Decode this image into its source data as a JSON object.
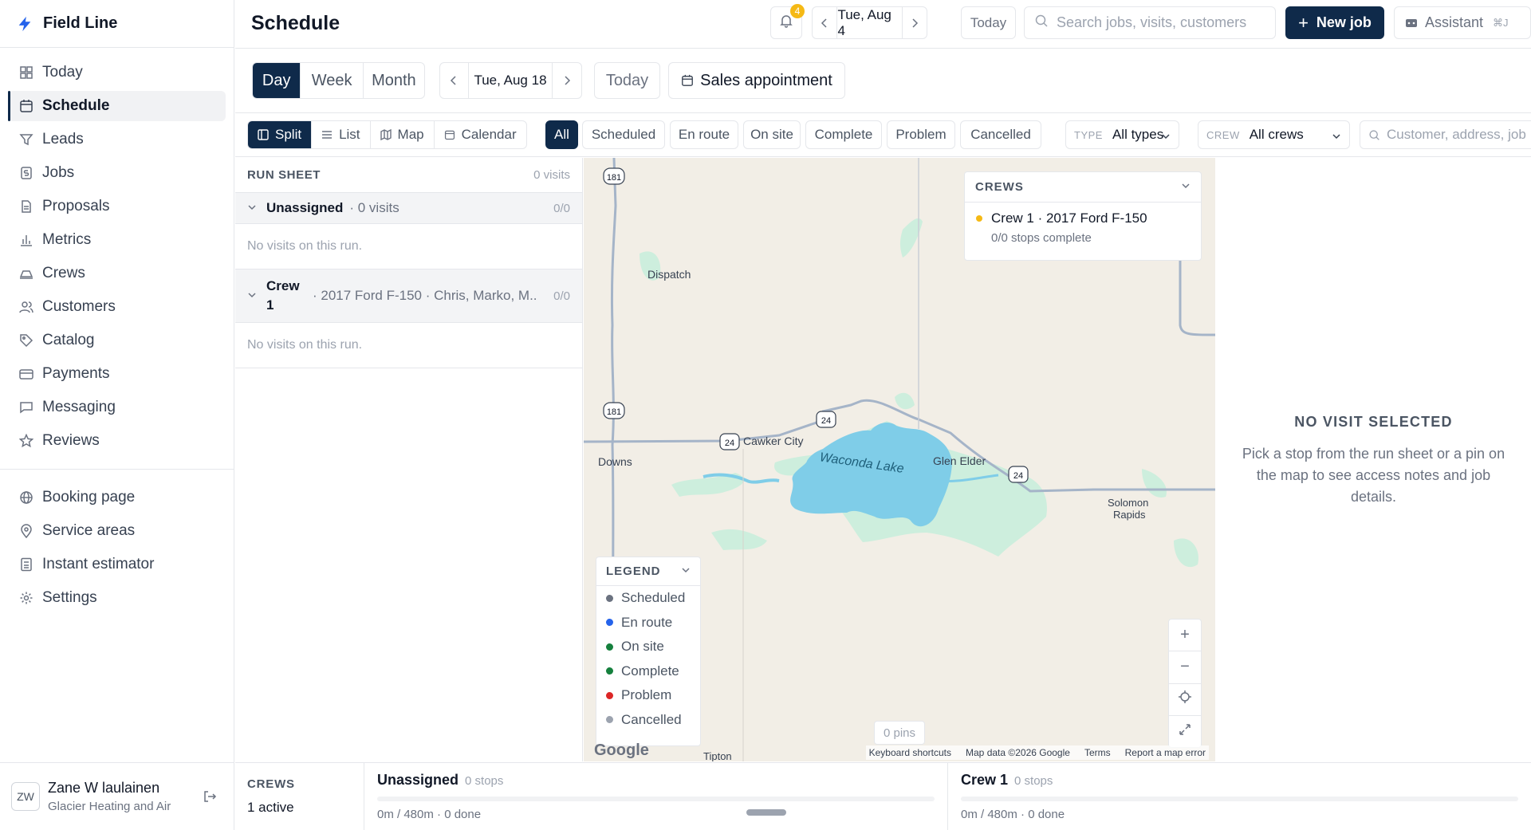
{
  "app": {
    "name": "Field Line"
  },
  "sidebar": {
    "items": [
      {
        "label": "Today",
        "icon": "grid-icon"
      },
      {
        "label": "Schedule",
        "icon": "calendar-icon",
        "active": true
      },
      {
        "label": "Leads",
        "icon": "funnel-icon"
      },
      {
        "label": "Jobs",
        "icon": "dollar-doc-icon"
      },
      {
        "label": "Proposals",
        "icon": "document-icon"
      },
      {
        "label": "Metrics",
        "icon": "bar-chart-icon"
      },
      {
        "label": "Crews",
        "icon": "truck-icon"
      },
      {
        "label": "Customers",
        "icon": "users-icon"
      },
      {
        "label": "Catalog",
        "icon": "tag-icon"
      },
      {
        "label": "Payments",
        "icon": "credit-card-icon"
      },
      {
        "label": "Messaging",
        "icon": "chat-icon"
      },
      {
        "label": "Reviews",
        "icon": "star-icon"
      }
    ],
    "secondary": [
      {
        "label": "Booking page",
        "icon": "globe-icon"
      },
      {
        "label": "Service areas",
        "icon": "pin-icon"
      },
      {
        "label": "Instant estimator",
        "icon": "calculator-icon"
      },
      {
        "label": "Settings",
        "icon": "gear-icon"
      }
    ],
    "user": {
      "initials": "ZW",
      "name": "Zane W laulainen",
      "org": "Glacier Heating and Air"
    }
  },
  "header": {
    "title": "Schedule",
    "notification_count": "4",
    "date": "Tue, Aug 4",
    "today_label": "Today",
    "search_placeholder": "Search jobs, visits, customers",
    "new_job_label": "New job",
    "assistant_label": "Assistant",
    "assistant_shortcut": "⌘J"
  },
  "toolbar": {
    "ranges": [
      "Day",
      "Week",
      "Month"
    ],
    "active_range": "Day",
    "date": "Tue, Aug 18",
    "today_label": "Today",
    "appointment_type": "Sales appointment"
  },
  "filters": {
    "views": [
      "Split",
      "List",
      "Map",
      "Calendar"
    ],
    "active_view": "Split",
    "statuses": [
      "All",
      "Scheduled",
      "En route",
      "On site",
      "Complete",
      "Problem",
      "Cancelled"
    ],
    "active_status": "All",
    "type_label": "TYPE",
    "type_value": "All types",
    "crew_label": "CREW",
    "crew_value": "All crews",
    "search_placeholder": "Customer, address, job"
  },
  "run_sheet": {
    "title": "RUN SHEET",
    "count": "0 visits",
    "groups": [
      {
        "name": "Unassigned",
        "sub": "· 0 visits",
        "count": "0/0",
        "empty": "No visits on this run."
      },
      {
        "name": "Crew 1",
        "sub": "· 2017 Ford F-150 · Chris, Marko, M...",
        "count": "0/0",
        "empty": "No visits on this run."
      }
    ]
  },
  "map": {
    "crews_title": "CREWS",
    "crew_name": "Crew 1 · 2017 Ford F-150",
    "crew_status": "0/0 stops complete",
    "legend_title": "LEGEND",
    "legend": [
      {
        "label": "Scheduled",
        "color": "#6b7280"
      },
      {
        "label": "En route",
        "color": "#2563eb"
      },
      {
        "label": "On site",
        "color": "#15803d"
      },
      {
        "label": "Complete",
        "color": "#15803d"
      },
      {
        "label": "Problem",
        "color": "#dc2626"
      },
      {
        "label": "Cancelled",
        "color": "#9ca3af"
      }
    ],
    "places": {
      "dispatch": "Dispatch",
      "cawker": "Cawker City",
      "downs": "Downs",
      "lake": "Waconda Lake",
      "glen": "Glen Elder",
      "solomon1": "Solomon",
      "solomon2": "Rapids",
      "tipton": "Tipton"
    },
    "routes": {
      "r181": "181",
      "r24": "24"
    },
    "pins_label": "0 pins",
    "attribution": {
      "shortcuts": "Keyboard shortcuts",
      "data": "Map data ©2026 Google",
      "terms": "Terms",
      "report": "Report a map error"
    },
    "provider": "Google"
  },
  "detail": {
    "title": "NO VISIT SELECTED",
    "text": "Pick a stop from the run sheet or a pin on the map to see access notes and job details."
  },
  "crews_bar": {
    "label": "CREWS",
    "active": "1 active",
    "columns": [
      {
        "name": "Unassigned",
        "stops": "0 stops",
        "info": "0m / 480m · 0 done"
      },
      {
        "name": "Crew 1",
        "stops": "0 stops",
        "info": "0m / 480m · 0 done"
      }
    ]
  },
  "colors": {
    "primary": "#0f2a4a",
    "badge": "#f5b915",
    "water": "#7fcde8",
    "park": "#cdeedd"
  }
}
